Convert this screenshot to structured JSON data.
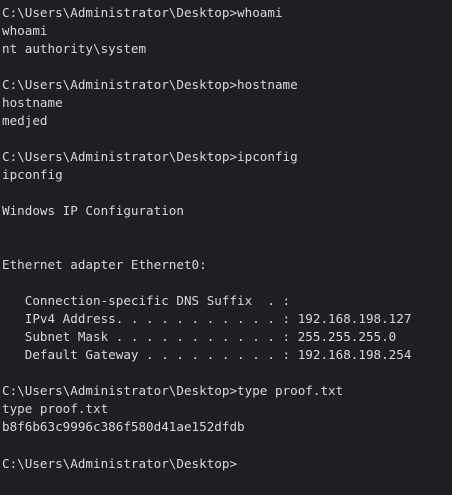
{
  "terminal": {
    "lines": [
      "C:\\Users\\Administrator\\Desktop>whoami",
      "whoami",
      "nt authority\\system",
      "",
      "C:\\Users\\Administrator\\Desktop>hostname",
      "hostname",
      "medjed",
      "",
      "C:\\Users\\Administrator\\Desktop>ipconfig",
      "ipconfig",
      "",
      "Windows IP Configuration",
      "",
      "",
      "Ethernet adapter Ethernet0:",
      "",
      "   Connection-specific DNS Suffix  . :",
      "   IPv4 Address. . . . . . . . . . . : 192.168.198.127",
      "   Subnet Mask . . . . . . . . . . . : 255.255.255.0",
      "   Default Gateway . . . . . . . . . : 192.168.198.254",
      "",
      "C:\\Users\\Administrator\\Desktop>type proof.txt",
      "type proof.txt",
      "b8f6b63c9996c386f580d41ae152dfdb",
      "",
      "C:\\Users\\Administrator\\Desktop>"
    ]
  },
  "colors": {
    "background": "#1e1e24",
    "foreground": "#d7d7dc"
  }
}
